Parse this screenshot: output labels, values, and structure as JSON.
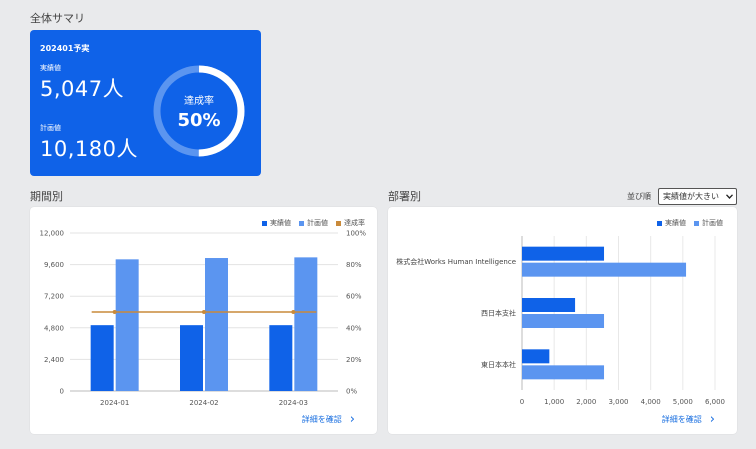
{
  "summary": {
    "title": "全体サマリ",
    "period": "202401予実",
    "actual_label": "実績値",
    "actual_value": "5,047人",
    "plan_label": "計画値",
    "plan_value": "10,180人",
    "rate_label": "達成率",
    "rate_value": "50%",
    "rate_fraction": 0.5
  },
  "period_section": {
    "title": "期間別",
    "legend": [
      "実績値",
      "計画値",
      "達成率"
    ],
    "link_label": "詳細を確認",
    "chevron": "›"
  },
  "dept_section": {
    "title": "部署別",
    "sort_label": "並び順",
    "sort_value": "実績値が大きい",
    "legend": [
      "実績値",
      "計画値"
    ],
    "link_label": "詳細を確認",
    "chevron": "›"
  },
  "colors": {
    "actual": "#0f62e8",
    "plan": "#5b95f0",
    "rate": "#c98a3a",
    "card": "#0f62e8"
  },
  "chart_data": [
    {
      "type": "bar",
      "categories": [
        "2024-01",
        "2024-02",
        "2024-03"
      ],
      "series": [
        {
          "name": "実績値",
          "values": [
            5000,
            5000,
            5000
          ]
        },
        {
          "name": "計画値",
          "values": [
            10000,
            10100,
            10150
          ]
        },
        {
          "name": "達成率",
          "type": "line",
          "axis": "right",
          "values": [
            50,
            50,
            50
          ]
        }
      ],
      "yticks_left": [
        "12,000",
        "9,600",
        "7,200",
        "4,800",
        "2,400",
        "0"
      ],
      "yticks_right": [
        "100%",
        "80%",
        "60%",
        "40%",
        "20%",
        "0%"
      ],
      "ylim": [
        0,
        12000
      ],
      "ylim_right": [
        0,
        100
      ],
      "grid": true,
      "legend_position": "top-right"
    },
    {
      "type": "bar",
      "orientation": "horizontal",
      "categories": [
        "株式会社Works Human Intelligence",
        "西日本支社",
        "東日本本社"
      ],
      "series": [
        {
          "name": "実績値",
          "values": [
            2550,
            1650,
            850
          ]
        },
        {
          "name": "計画値",
          "values": [
            5100,
            2550,
            2550
          ]
        }
      ],
      "xticks": [
        "0",
        "1,000",
        "2,000",
        "3,000",
        "4,000",
        "5,000",
        "6,000"
      ],
      "xlim": [
        0,
        6000
      ],
      "grid": true,
      "legend_position": "top-right"
    }
  ]
}
